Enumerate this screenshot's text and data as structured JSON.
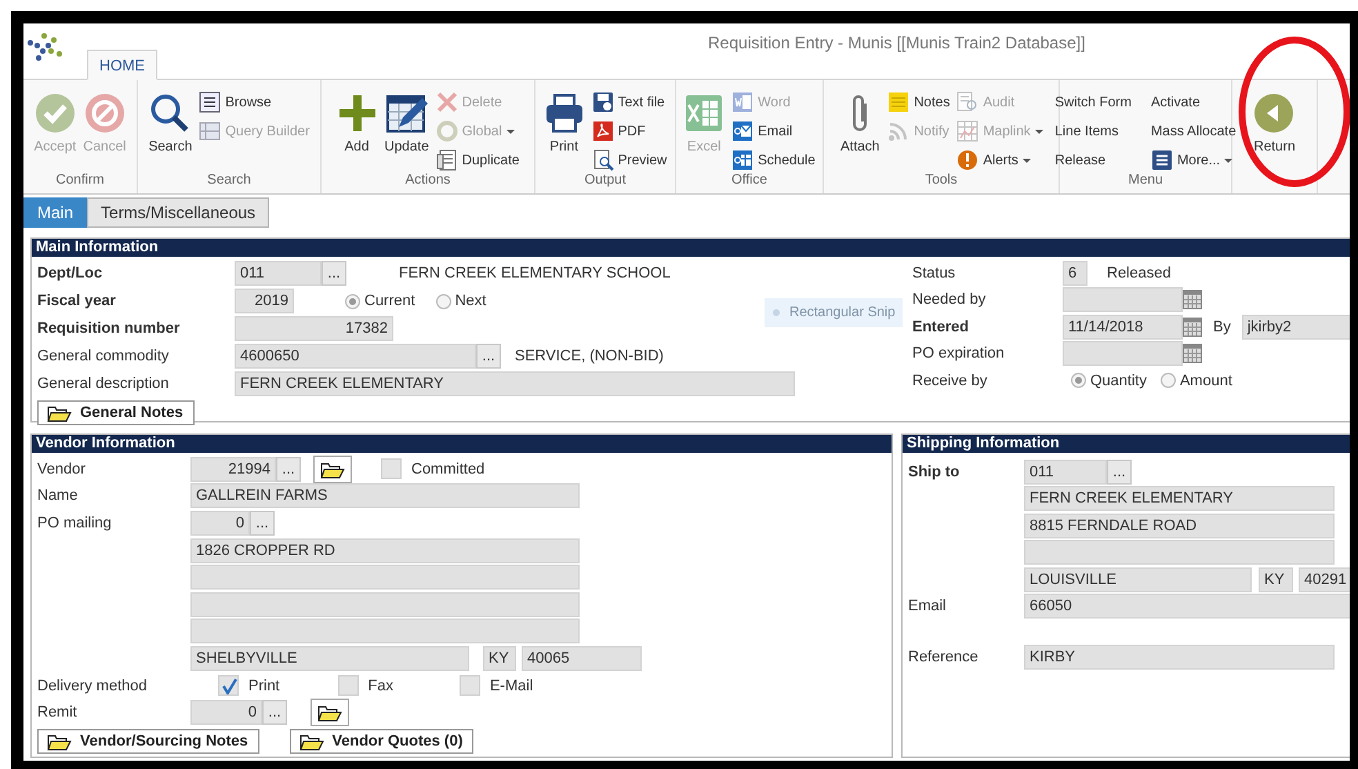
{
  "window": {
    "title": "Requisition Entry - Munis [[Munis Train2 Database]]"
  },
  "ribbon_tabs": [
    {
      "label": "HOME",
      "selected": true
    }
  ],
  "ribbon_groups": [
    {
      "label": "Confirm",
      "columns": [
        [
          {
            "label": "Accept",
            "kind": "large",
            "disabled": true,
            "dropdown": false
          }
        ],
        [
          {
            "label": "Cancel",
            "kind": "large",
            "disabled": true,
            "dropdown": false
          }
        ]
      ]
    },
    {
      "label": "Search",
      "columns": [
        [
          {
            "label": "Search",
            "kind": "large",
            "disabled": false,
            "dropdown": false
          }
        ],
        [
          {
            "label": "Browse",
            "kind": "small",
            "disabled": false,
            "dropdown": false
          },
          {
            "label": "Query Builder",
            "kind": "small",
            "disabled": true,
            "dropdown": false
          }
        ]
      ]
    },
    {
      "label": "Actions",
      "columns": [
        [
          {
            "label": "Add",
            "kind": "large",
            "disabled": false,
            "dropdown": false
          }
        ],
        [
          {
            "label": "Update",
            "kind": "large",
            "disabled": false,
            "dropdown": false
          }
        ],
        [
          {
            "label": "Delete",
            "kind": "small",
            "disabled": true,
            "dropdown": false
          },
          {
            "label": "Global",
            "kind": "small",
            "disabled": true,
            "dropdown": true
          },
          {
            "label": "Duplicate",
            "kind": "small",
            "disabled": false,
            "dropdown": false
          }
        ]
      ]
    },
    {
      "label": "Output",
      "columns": [
        [
          {
            "label": "Print",
            "kind": "large",
            "disabled": false,
            "dropdown": false
          }
        ],
        [
          {
            "label": "Text file",
            "kind": "small",
            "disabled": false,
            "dropdown": false
          },
          {
            "label": "PDF",
            "kind": "small",
            "disabled": false,
            "dropdown": false
          },
          {
            "label": "Preview",
            "kind": "small",
            "disabled": false,
            "dropdown": false
          }
        ]
      ]
    },
    {
      "label": "Office",
      "columns": [
        [
          {
            "label": "Excel",
            "kind": "large",
            "disabled": true,
            "dropdown": false
          }
        ],
        [
          {
            "label": "Word",
            "kind": "small",
            "disabled": true,
            "dropdown": false
          },
          {
            "label": "Email",
            "kind": "small",
            "disabled": false,
            "dropdown": false
          },
          {
            "label": "Schedule",
            "kind": "small",
            "disabled": false,
            "dropdown": false
          }
        ]
      ]
    },
    {
      "label": "Tools",
      "columns": [
        [
          {
            "label": "Attach",
            "kind": "large",
            "disabled": false,
            "dropdown": false
          }
        ],
        [
          {
            "label": "Notes",
            "kind": "small",
            "disabled": false,
            "dropdown": false
          },
          {
            "label": "Notify",
            "kind": "small",
            "disabled": true,
            "dropdown": false
          }
        ],
        [
          {
            "label": "Audit",
            "kind": "small",
            "disabled": true,
            "dropdown": false
          },
          {
            "label": "Maplink",
            "kind": "small",
            "disabled": true,
            "dropdown": true
          },
          {
            "label": "Alerts",
            "kind": "small",
            "disabled": false,
            "dropdown": true
          }
        ]
      ]
    },
    {
      "label": "Menu",
      "columns": [
        [
          {
            "label": "Switch Form",
            "kind": "text",
            "disabled": false,
            "dropdown": false
          },
          {
            "label": "Line Items",
            "kind": "text",
            "disabled": false,
            "dropdown": false
          },
          {
            "label": "Release",
            "kind": "text",
            "disabled": false,
            "dropdown": false
          }
        ],
        [
          {
            "label": "Activate",
            "kind": "text",
            "disabled": false,
            "dropdown": false
          },
          {
            "label": "Mass Allocate",
            "kind": "text",
            "disabled": false,
            "dropdown": false
          },
          {
            "label": "More...",
            "kind": "small",
            "disabled": false,
            "dropdown": true
          }
        ]
      ]
    },
    {
      "columns": [
        [
          {
            "label": "Return",
            "kind": "large",
            "disabled": false,
            "dropdown": false
          }
        ]
      ]
    }
  ],
  "annotation": {
    "kind": "circle"
  },
  "form_tabs": [
    {
      "label": "Main",
      "selected": true
    },
    {
      "label": "Terms/Miscellaneous",
      "selected": false
    }
  ],
  "main_information": {
    "title": "Main Information",
    "dept_loc": {
      "label": "Dept/Loc",
      "required": true,
      "value": "011",
      "button": "...",
      "description": "FERN CREEK ELEMENTARY SCHOOL"
    },
    "fiscal_year": {
      "label": "Fiscal year",
      "required": true,
      "value": "2019",
      "options": [
        {
          "label": "Current",
          "selected": true
        },
        {
          "label": "Next",
          "selected": false
        }
      ]
    },
    "requisition_number": {
      "label": "Requisition number",
      "required": true,
      "value": "17382"
    },
    "general_commodity": {
      "label": "General commodity",
      "required": false,
      "value": "4600650",
      "button": "...",
      "description": "SERVICE, (NON-BID)"
    },
    "general_description": {
      "label": "General description",
      "required": false,
      "value": "FERN CREEK ELEMENTARY"
    },
    "notes_button": "General Notes",
    "status": {
      "label": "Status",
      "required": false,
      "value": "6",
      "description": "Released"
    },
    "needed_by": {
      "label": "Needed by",
      "required": false
    },
    "entered": {
      "label": "Entered",
      "required": true,
      "value": "11/14/2018",
      "by_label": "By",
      "by_value": "jkirby2"
    },
    "po_expiration": {
      "label": "PO expiration",
      "required": false
    },
    "receive_by": {
      "label": "Receive by",
      "required": false,
      "options": [
        {
          "label": "Quantity",
          "selected": true
        },
        {
          "label": "Amount",
          "selected": false
        }
      ]
    }
  },
  "snip_tooltip": "Rectangular Snip",
  "vendor_information": {
    "title": "Vendor Information",
    "vendor": {
      "label": "Vendor",
      "required": false,
      "value": "21994",
      "button": "...",
      "committed": {
        "label": "Committed",
        "checked": false
      }
    },
    "name": {
      "label": "Name",
      "required": false,
      "value": "GALLREIN FARMS"
    },
    "po_mailing": {
      "label": "PO mailing",
      "required": false,
      "value": "0",
      "button": "...",
      "address_lines": [
        "1826 CROPPER RD"
      ],
      "city": "SHELBYVILLE",
      "state": "KY",
      "zip": "40065"
    },
    "delivery_method": {
      "label": "Delivery method",
      "required": false,
      "options": [
        {
          "label": "Print",
          "checked": true
        },
        {
          "label": "Fax",
          "checked": false
        },
        {
          "label": "E-Mail",
          "checked": false
        }
      ]
    },
    "remit": {
      "label": "Remit",
      "required": false,
      "value": "0",
      "button": "..."
    },
    "buttons": [
      "Vendor/Sourcing Notes",
      "Vendor Quotes (0)"
    ]
  },
  "shipping_information": {
    "title": "Shipping Information",
    "ship_to": {
      "label": "Ship to",
      "required": true,
      "value": "011",
      "button": "...",
      "address_lines": [
        "FERN CREEK ELEMENTARY",
        "8815 FERNDALE ROAD"
      ],
      "city": "LOUISVILLE",
      "state": "KY",
      "zip": "40291"
    },
    "email": {
      "label": "Email",
      "required": false,
      "value": "66050"
    },
    "reference": {
      "label": "Reference",
      "required": false,
      "value": "KIRBY"
    }
  }
}
